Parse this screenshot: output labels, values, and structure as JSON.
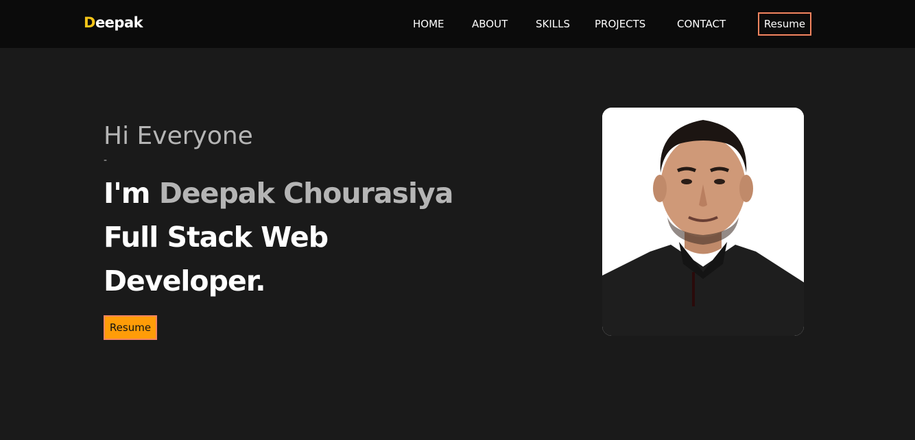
{
  "header": {
    "logo_first": "D",
    "logo_rest": "eepak",
    "nav": [
      "HOME",
      "ABOUT",
      "SKILLS",
      "PROJECTS",
      "CONTACT"
    ],
    "resume_label": "Resume"
  },
  "hero": {
    "greeting": "Hi Everyone",
    "dash": "-",
    "im": "I'm",
    "name": "Deepak Chourasiya",
    "role_line1": "Full Stack Web",
    "role_line2": "Developer.",
    "resume_label": "Resume"
  },
  "colors": {
    "logo_accent": "#f5c518",
    "button_bg": "#ff9c08",
    "button_border": "#f4845f",
    "page_bg": "#1a1a1a",
    "navbar_bg": "#0b0b0b"
  }
}
